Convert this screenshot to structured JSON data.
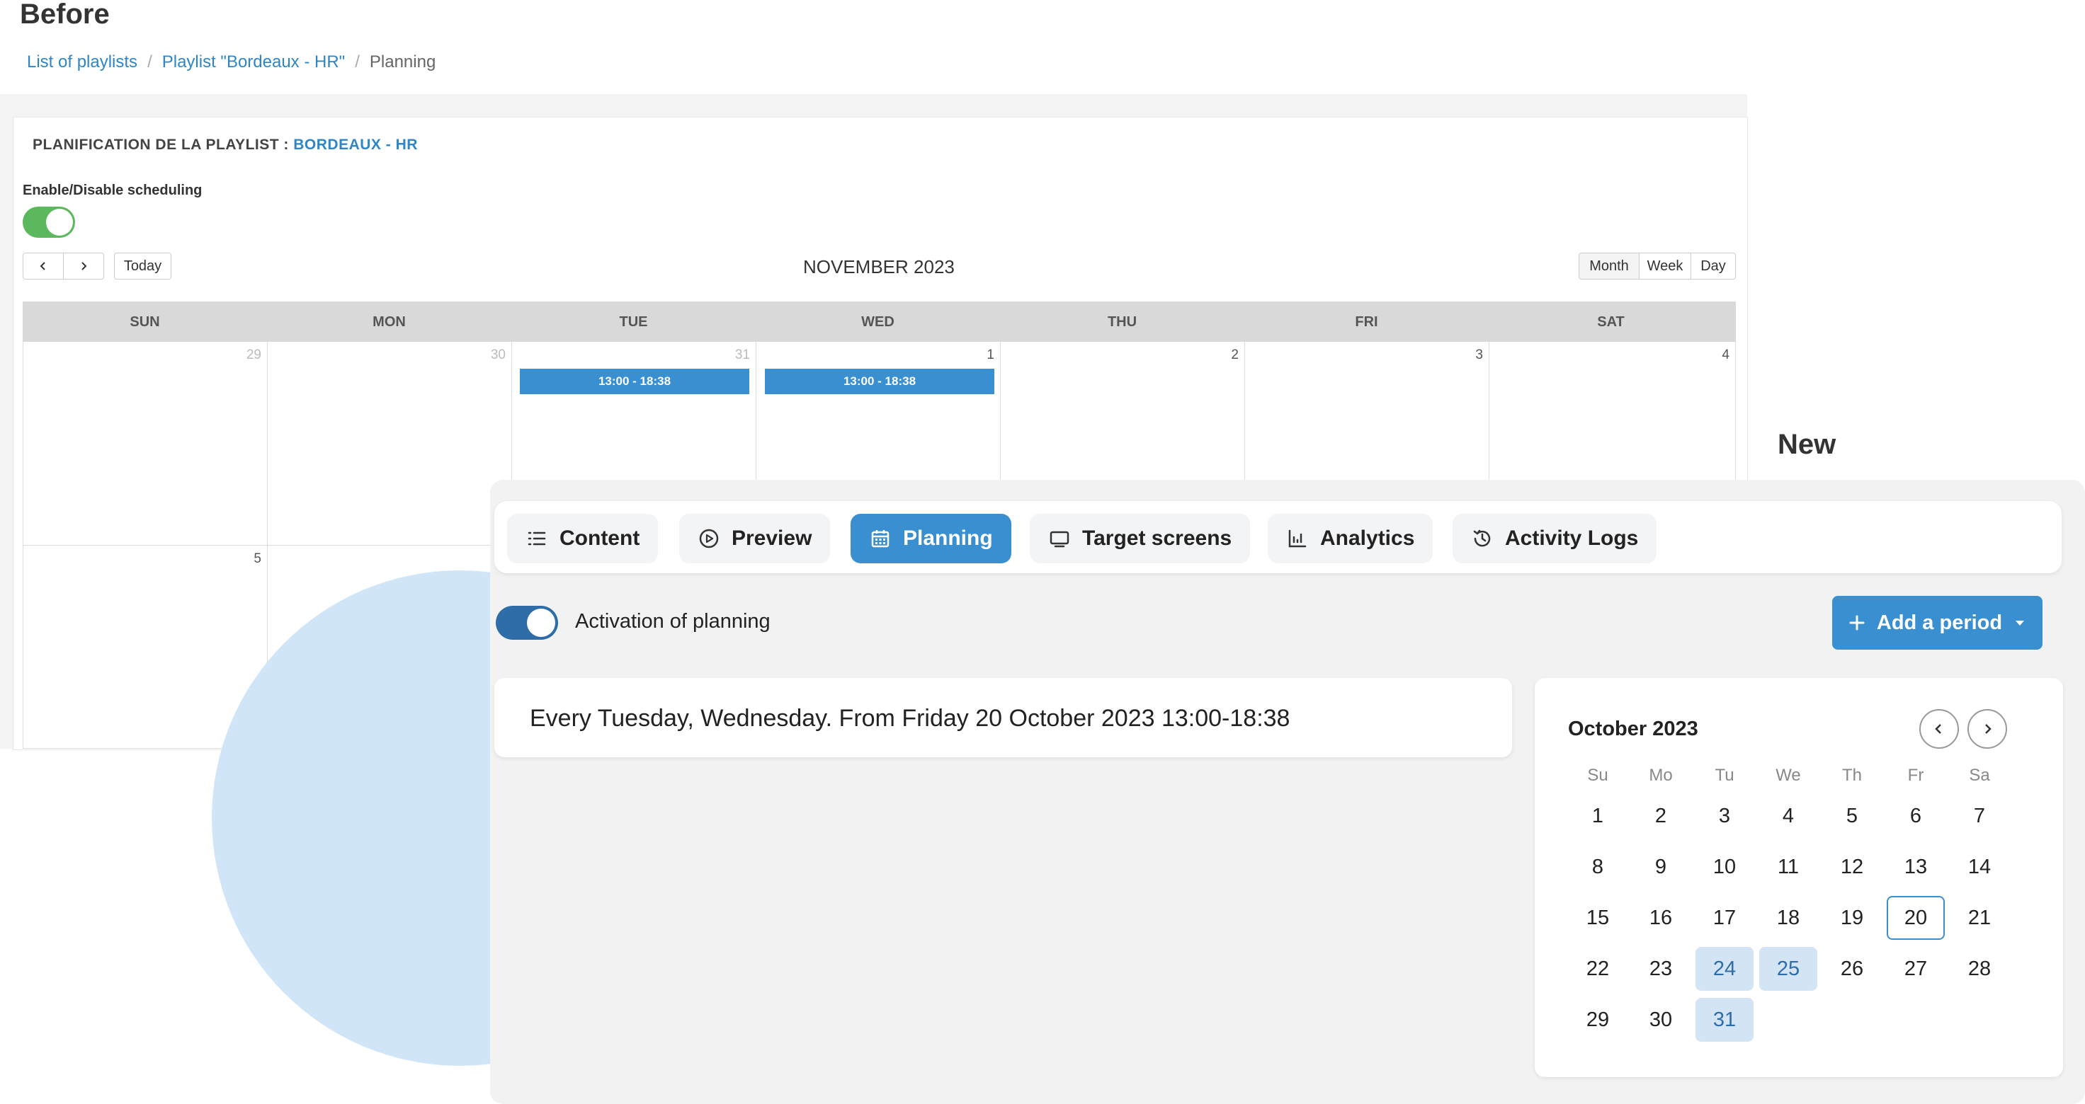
{
  "before": {
    "title": "Before",
    "breadcrumb": [
      "List of playlists",
      "Playlist \"Bordeaux - HR\"",
      "Planning"
    ],
    "heading_prefix": "PLANIFICATION DE LA PLAYLIST :",
    "heading_playlist": "BORDEAUX - HR",
    "scheduling_label": "Enable/Disable scheduling",
    "scheduling_enabled": true,
    "today_label": "Today",
    "month_title": "NOVEMBER 2023",
    "views": [
      "Month",
      "Week",
      "Day"
    ],
    "active_view": "Month",
    "weekdays": [
      "SUN",
      "MON",
      "TUE",
      "WED",
      "THU",
      "FRI",
      "SAT"
    ],
    "week1_days": [
      "29",
      "30",
      "31",
      "1",
      "2",
      "3",
      "4"
    ],
    "week2_days": [
      "5"
    ],
    "events": [
      "13:00 - 18:38",
      "13:00 - 18:38"
    ]
  },
  "new": {
    "title": "New",
    "tabs": [
      "Content",
      "Preview",
      "Planning",
      "Target screens",
      "Analytics",
      "Activity Logs"
    ],
    "active_tab": "Planning",
    "activation_label": "Activation of planning",
    "activation_enabled": true,
    "add_period_label": "Add a period",
    "period_summary": "Every Tuesday, Wednesday. From Friday 20 October 2023 13:00-18:38",
    "calendar": {
      "month_label": "October 2023",
      "weekdays": [
        "Su",
        "Mo",
        "Tu",
        "We",
        "Th",
        "Fr",
        "Sa"
      ],
      "weeks": [
        [
          "1",
          "2",
          "3",
          "4",
          "5",
          "6",
          "7"
        ],
        [
          "8",
          "9",
          "10",
          "11",
          "12",
          "13",
          "14"
        ],
        [
          "15",
          "16",
          "17",
          "18",
          "19",
          "20",
          "21"
        ],
        [
          "22",
          "23",
          "24",
          "25",
          "26",
          "27",
          "28"
        ],
        [
          "29",
          "30",
          "31"
        ]
      ],
      "today": "20",
      "highlighted": [
        "24",
        "25",
        "31"
      ]
    }
  },
  "colors": {
    "accent": "#3a8fd0",
    "toggle_old": "#5cb85c",
    "toggle_new": "#2f6da8",
    "highlight": "#d3e5f5"
  }
}
